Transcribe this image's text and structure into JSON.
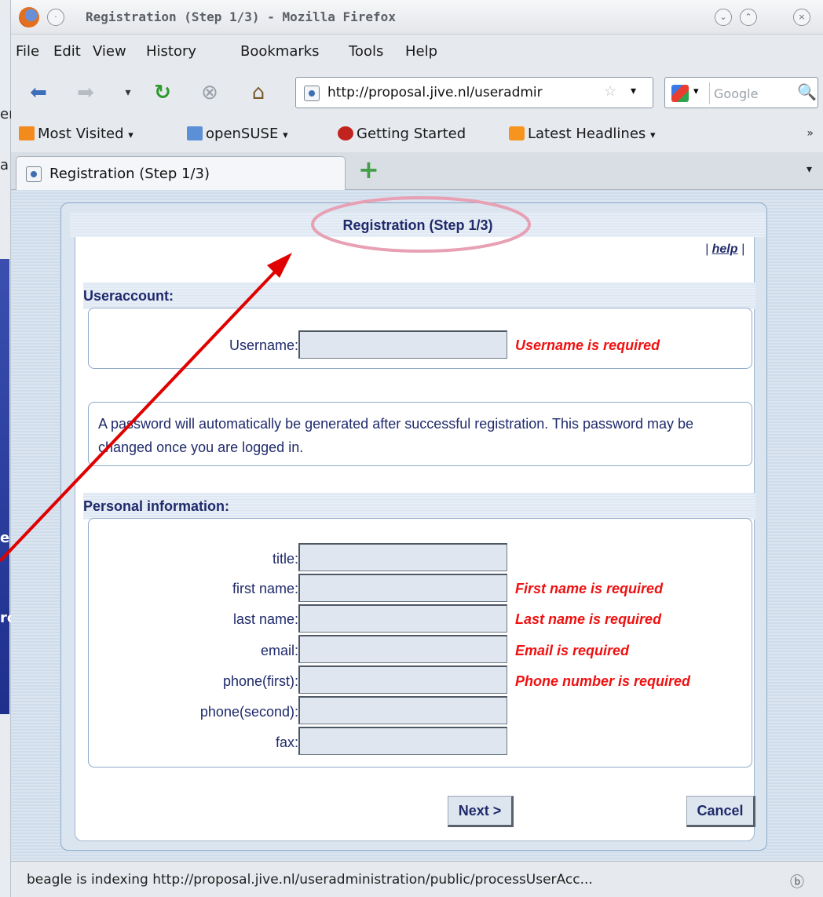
{
  "window": {
    "title": "Registration (Step 1/3) - Mozilla Firefox"
  },
  "menu": {
    "items": [
      "File",
      "Edit",
      "View",
      "History",
      "Bookmarks",
      "Tools",
      "Help"
    ]
  },
  "navigation": {
    "url": "http://proposal.jive.nl/useradmir",
    "search_placeholder": "Google"
  },
  "bookmarks": {
    "items": [
      "Most Visited",
      "openSUSE",
      "Getting Started",
      "Latest Headlines"
    ],
    "overflow": "»"
  },
  "tabs": {
    "active_label": "Registration (Step 1/3)",
    "new_tab": "+"
  },
  "form": {
    "title": "Registration (Step 1/3)",
    "help_link": "help",
    "help_pipe_left": "|",
    "help_pipe_right": "|",
    "useraccount": {
      "heading": "Useraccount:",
      "username_label": "Username:",
      "username_error": "Username is required",
      "username_value": ""
    },
    "password_note": "A password will automatically be generated after successful registration. This password may be changed once you are logged in.",
    "personal": {
      "heading": "Personal information:",
      "fields": [
        {
          "label": "title:",
          "value": "",
          "error": ""
        },
        {
          "label": "first name:",
          "value": "",
          "error": "First name is required"
        },
        {
          "label": "last name:",
          "value": "",
          "error": "Last name is required"
        },
        {
          "label": "email:",
          "value": "",
          "error": "Email is required"
        },
        {
          "label": "phone(first):",
          "value": "",
          "error": "Phone number is required"
        },
        {
          "label": "phone(second):",
          "value": "",
          "error": ""
        },
        {
          "label": "fax:",
          "value": "",
          "error": ""
        }
      ]
    },
    "buttons": {
      "next": "Next >",
      "cancel": "Cancel"
    }
  },
  "status": {
    "text": "beagle is indexing http://proposal.jive.nl/useradministration/public/processUserAcc..."
  },
  "annotation": {
    "highlight_color": "#e8a0b4",
    "arrow_color": "#e00000"
  },
  "background_window": {
    "fragments": [
      "er",
      "a",
      "e",
      "rc"
    ]
  }
}
